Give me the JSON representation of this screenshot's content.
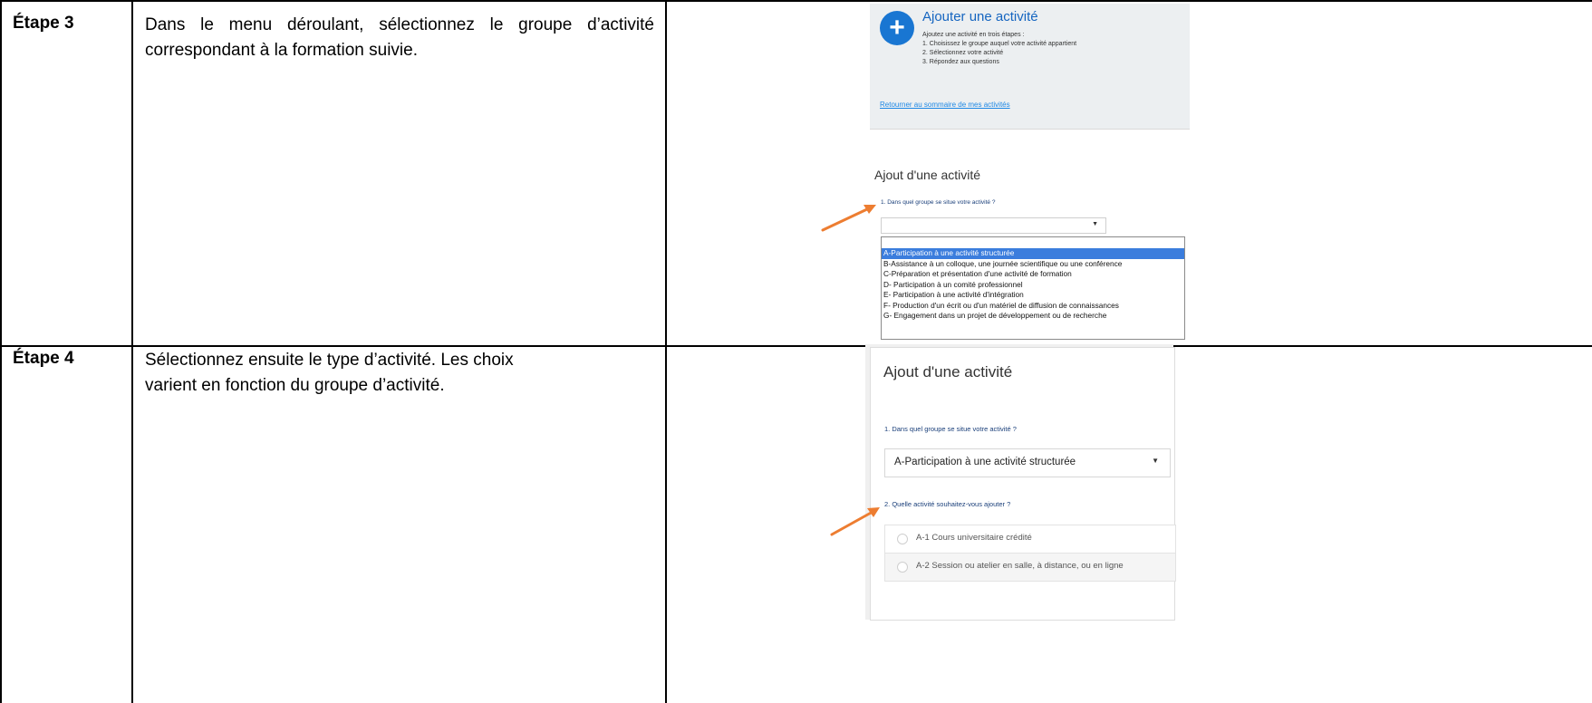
{
  "steps": [
    {
      "label": "Étape 3",
      "instruction": "Dans le menu déroulant, sélectionnez le groupe d’activité correspondant à la formation suivie.",
      "screenshot": {
        "panel_title": "Ajouter une activité",
        "panel_intro": "Ajoutez une activité en trois étapes :",
        "panel_steps": [
          "1. Choisissez le groupe auquel votre activité appartient",
          "2. Sélectionnez votre activité",
          "3. Répondez aux questions"
        ],
        "back_link": "Retourner au sommaire de mes activités",
        "form_heading": "Ajout d'une activité",
        "question_1": "1. Dans quel groupe se situe votre activité ?",
        "select_value": "",
        "dropdown_options": [
          "A-Participation à une activité structurée",
          "B-Assistance à un colloque, une journée scientifique ou une conférence",
          "C-Préparation et présentation d'une activité de formation",
          "D- Participation à un comité professionnel",
          "E- Participation à une activité d'intégration",
          "F- Production d'un écrit ou d'un matériel de diffusion de connaissances",
          "G- Engagement dans un projet de développement ou de recherche"
        ],
        "selected_option": "A-Participation à une activité structurée"
      }
    },
    {
      "label": "Étape 4",
      "instruction_lines": [
        "Sélectionnez ensuite le type d’activité. Les choix",
        "varient en fonction du groupe d’activité."
      ],
      "screenshot": {
        "form_heading": "Ajout d'une activité",
        "question_1": "1. Dans quel groupe se situe votre activité ?",
        "select_value": "A-Participation à une activité structurée",
        "question_2": "2. Quelle activité souhaitez-vous ajouter ?",
        "radio_options": [
          "A-1 Cours universitaire crédité",
          "A-2 Session ou atelier en salle, à distance, ou en ligne"
        ]
      }
    }
  ],
  "colors": {
    "arrow": "#ed7d31",
    "accent_blue": "#1976d2",
    "selected_highlight": "#3b7ddd"
  },
  "icons": [
    "plus-icon",
    "caret-down-icon",
    "arrow-pointer-icon",
    "radio-icon"
  ]
}
